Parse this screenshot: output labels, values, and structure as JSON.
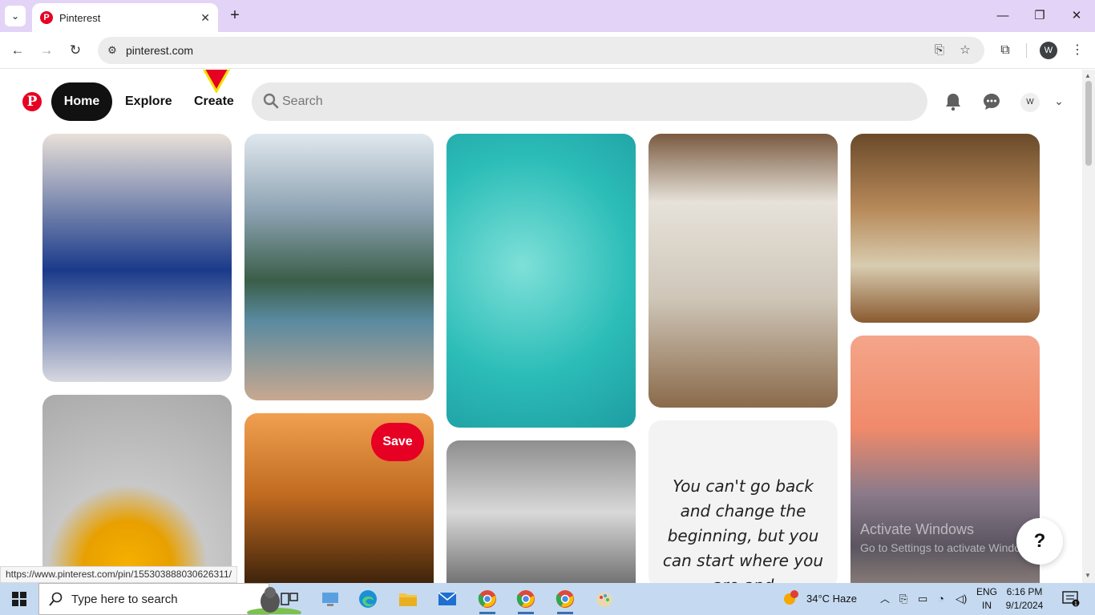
{
  "browser": {
    "tab_title": "Pinterest",
    "url": "pinterest.com",
    "profile_initial": "W"
  },
  "header": {
    "home_label": "Home",
    "explore_label": "Explore",
    "create_label": "Create",
    "search_placeholder": "Search",
    "avatar_initial": "W"
  },
  "pins": [
    {
      "name": "pin-drift-magazine",
      "colors": [
        "#1a2a6a",
        "#e8e8f0"
      ]
    },
    {
      "name": "pin-mountain-lake",
      "colors": [
        "#b9cad8",
        "#3c5e46"
      ]
    },
    {
      "name": "pin-surfers-ocean",
      "colors": [
        "#2ec4c0",
        "#6fd9d0"
      ]
    },
    {
      "name": "pin-rustic-living-room",
      "colors": [
        "#d9d2c6",
        "#8a6a4a"
      ]
    },
    {
      "name": "pin-cozy-lounge-rug",
      "colors": [
        "#9b6a3d",
        "#d8cbb0"
      ]
    },
    {
      "name": "pin-mango-blender",
      "colors": [
        "#c8c8c8",
        "#f0a800"
      ]
    },
    {
      "name": "pin-palm-sunset",
      "colors": [
        "#e09040",
        "#2a1a0a"
      ]
    },
    {
      "name": "pin-sneakers",
      "colors": [
        "#8a8a8a",
        "#e8e8e8"
      ]
    },
    {
      "name": "pin-beach-sunset",
      "colors": [
        "#f08a70",
        "#6a6f80"
      ]
    }
  ],
  "save_label": "Save",
  "quote": "You can't go back and change the beginning, but you can start where you are and",
  "watermark": {
    "line1": "Activate Windows",
    "line2": "Go to Settings to activate Windows."
  },
  "help_label": "?",
  "status_url": "https://www.pinterest.com/pin/155303888030626311/",
  "taskbar": {
    "search_text": "Type here to search",
    "weather": "34°C  Haze",
    "lang_line1": "ENG",
    "lang_line2": "IN",
    "time": "6:16 PM",
    "date": "9/1/2024",
    "notification_count": "1"
  },
  "colors": {
    "pinterest_red": "#e60023",
    "tabstrip": "#e3d4f7",
    "taskbar": "#c5daf0"
  }
}
